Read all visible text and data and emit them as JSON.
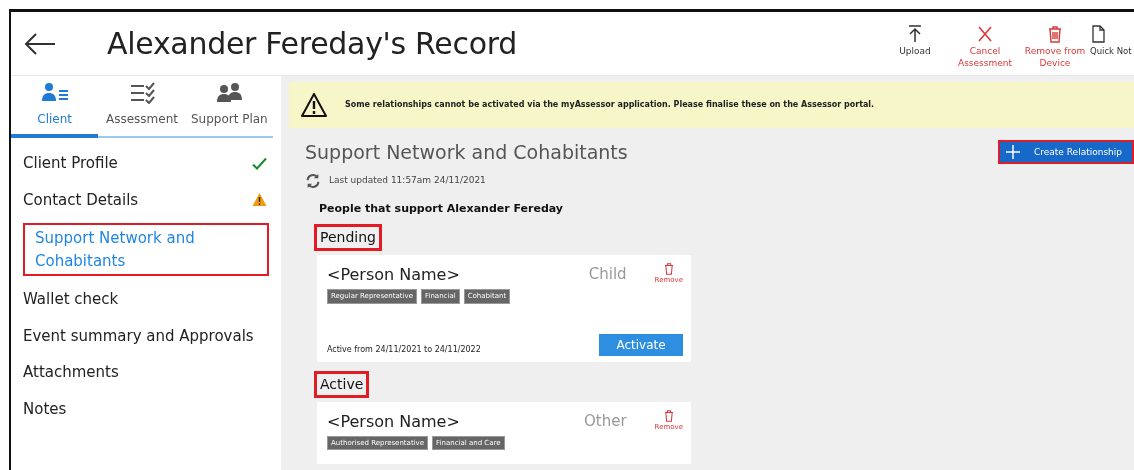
{
  "header": {
    "title": "Alexander Fereday's Record",
    "toolbar": [
      {
        "kind": "upload",
        "label": "Upload",
        "danger": false
      },
      {
        "kind": "cancel",
        "label": "Cancel Assessment",
        "danger": true
      },
      {
        "kind": "remove",
        "label": "Remove from Device",
        "danger": true
      },
      {
        "kind": "note",
        "label": "Quick Not",
        "danger": false
      }
    ]
  },
  "tabs": [
    {
      "kind": "client",
      "label": "Client",
      "selected": true
    },
    {
      "kind": "assessment",
      "label": "Assessment",
      "selected": false
    },
    {
      "kind": "plan",
      "label": "Support Plan",
      "selected": false
    }
  ],
  "sidebar": {
    "items": [
      {
        "label": "Client Profile",
        "kind": "complete",
        "selected": false,
        "highlighted": false
      },
      {
        "label": "Contact Details",
        "kind": "warning",
        "selected": false,
        "highlighted": false
      },
      {
        "label": "Support Network and Cohabitants",
        "kind": "plain",
        "selected": true,
        "highlighted": true
      },
      {
        "label": "Wallet check",
        "kind": "plain",
        "selected": false,
        "highlighted": false
      },
      {
        "label": "Event summary and Approvals",
        "kind": "plain",
        "selected": false,
        "highlighted": false
      },
      {
        "label": "Attachments",
        "kind": "plain",
        "selected": false,
        "highlighted": false
      },
      {
        "label": "Notes",
        "kind": "plain",
        "selected": false,
        "highlighted": false
      }
    ]
  },
  "banner": {
    "text": "Some relationships cannot be activated via the myAssessor application. Please finalise these on the Assessor portal."
  },
  "content": {
    "title": "Support Network and Cohabitants",
    "last_updated": "Last updated 11:57am 24/11/2021",
    "create_button": {
      "label": "Create Relationship",
      "highlighted": true
    },
    "subtitle": "People that support Alexander Fereday",
    "sections": [
      {
        "heading": "Pending",
        "highlighted": true,
        "people": [
          {
            "name": "<Person Name>",
            "relation": "Child",
            "remove": "Remove",
            "tags": [
              "Regular Representative",
              "Financial",
              "Cohabitant"
            ],
            "dates": "Active from 24/11/2021 to 24/11/2022",
            "action": "Activate"
          }
        ]
      },
      {
        "heading": "Active",
        "highlighted": true,
        "people": [
          {
            "name": "<Person Name>",
            "relation": "Other",
            "remove": "Remove",
            "tags": [
              "Authorised Representative",
              "Financial and Care"
            ]
          }
        ]
      }
    ]
  }
}
